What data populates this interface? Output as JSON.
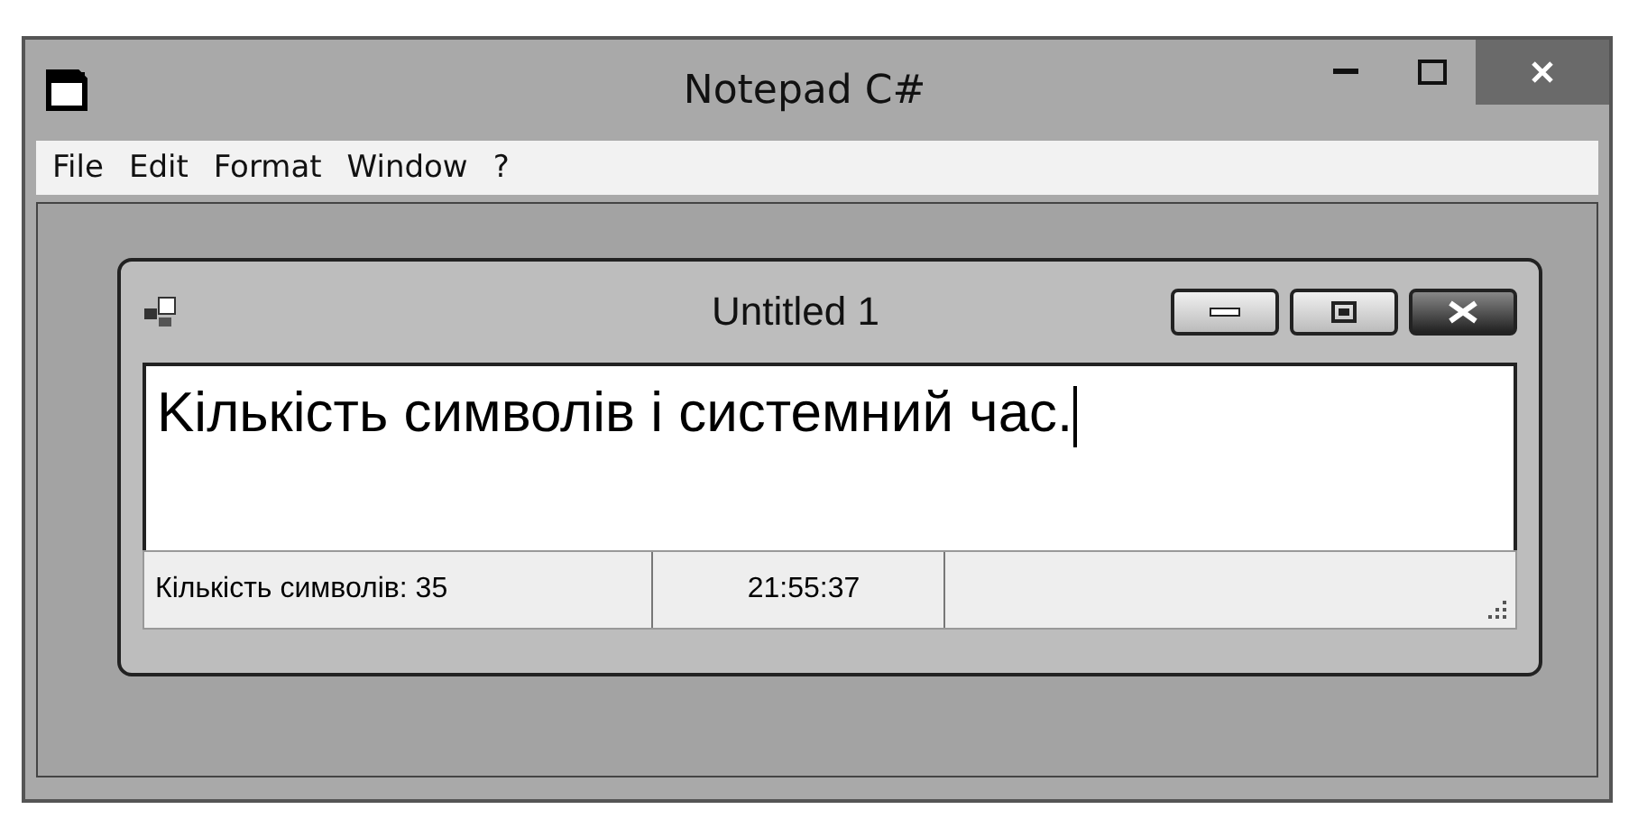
{
  "window": {
    "title": "Notepad C#"
  },
  "menu": [
    "File",
    "Edit",
    "Format",
    "Window",
    "?"
  ],
  "child": {
    "title": "Untitled 1",
    "text": "Kількість символів і системний час.",
    "status": [
      "Кількість символів: 35",
      "21:55:37"
    ]
  }
}
